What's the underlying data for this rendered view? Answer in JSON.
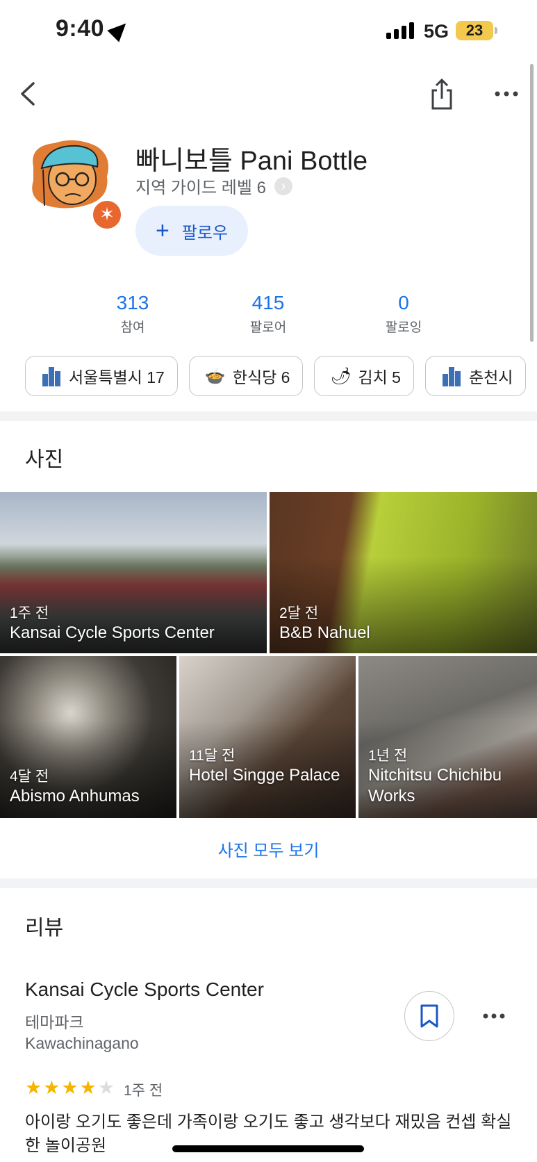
{
  "status_bar": {
    "time": "9:40",
    "network": "5G",
    "battery": "23"
  },
  "profile": {
    "name": "빠니보틀 Pani Bottle",
    "guide_level": "지역 가이드 레벨 6",
    "follow_label": "팔로우"
  },
  "stats": [
    {
      "value": "313",
      "label": "참여"
    },
    {
      "value": "415",
      "label": "팔로어"
    },
    {
      "value": "0",
      "label": "팔로잉"
    }
  ],
  "chips": [
    {
      "label": "서울특별시 17",
      "icon": "city-icon"
    },
    {
      "label": "한식당 6",
      "icon": "bowl-icon",
      "glyph": "🍲"
    },
    {
      "label": "김치 5",
      "icon": "chili-icon",
      "glyph": "🌶"
    },
    {
      "label": "춘천시",
      "icon": "city-icon"
    }
  ],
  "photos_section": {
    "title": "사진",
    "see_all": "사진 모두 보기",
    "items": [
      {
        "time": "1주 전",
        "name": "Kansai Cycle Sports Center"
      },
      {
        "time": "2달 전",
        "name": "B&B Nahuel"
      },
      {
        "time": "4달 전",
        "name": "Abismo Anhumas"
      },
      {
        "time": "11달 전",
        "name": "Hotel Singge Palace"
      },
      {
        "time": "1년 전",
        "name": "Nitchitsu Chichibu Works"
      }
    ]
  },
  "reviews_section": {
    "title": "리뷰",
    "review": {
      "place": "Kansai Cycle Sports Center",
      "category": "테마파크",
      "location": "Kawachinagano",
      "rating": 4,
      "rating_max": 5,
      "time": "1주 전",
      "text": "아이랑 오기도 좋은데 가족이랑 오기도 좋고 생각보다 재밌음 컨셉 확실한 놀이공원"
    }
  },
  "colors": {
    "accent": "#1a73e8",
    "follow_bg": "#e8f0fe",
    "badge": "#e8672f",
    "star": "#f4b400"
  }
}
